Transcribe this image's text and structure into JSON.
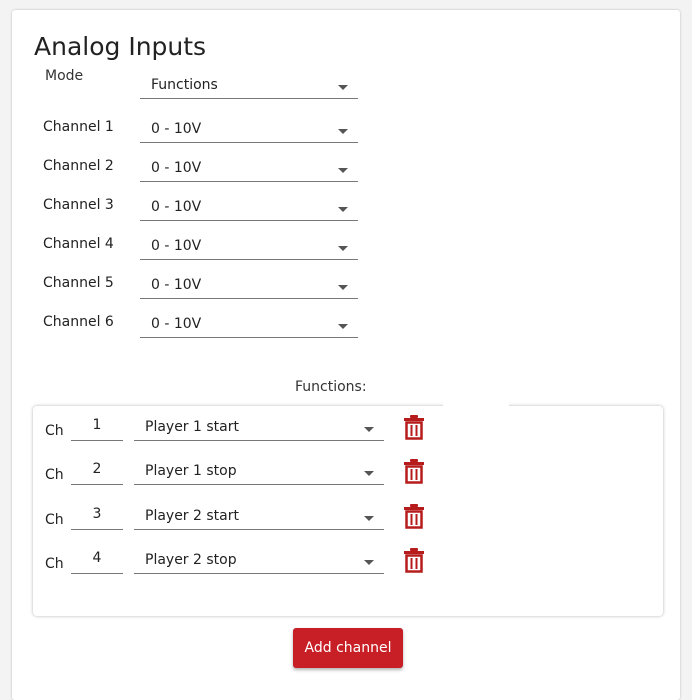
{
  "section": {
    "title": "Analog Inputs"
  },
  "mode": {
    "label": "Mode",
    "value": "Functions"
  },
  "channels": [
    {
      "label": "Channel 1",
      "value": "0 - 10V"
    },
    {
      "label": "Channel 2",
      "value": "0 - 10V"
    },
    {
      "label": "Channel 3",
      "value": "0 - 10V"
    },
    {
      "label": "Channel 4",
      "value": "0 - 10V"
    },
    {
      "label": "Channel 5",
      "value": "0 - 10V"
    },
    {
      "label": "Channel 6",
      "value": "0 - 10V"
    }
  ],
  "functions": {
    "heading": "Functions:",
    "rows": [
      {
        "ch_label": "Ch",
        "channel": "1",
        "function": "Player 1 start",
        "delete_icon": "trash-icon"
      },
      {
        "ch_label": "Ch",
        "channel": "2",
        "function": "Player 1 stop",
        "delete_icon": "trash-icon"
      },
      {
        "ch_label": "Ch",
        "channel": "3",
        "function": "Player 2 start",
        "delete_icon": "trash-icon"
      },
      {
        "ch_label": "Ch",
        "channel": "4",
        "function": "Player 2 stop",
        "delete_icon": "trash-icon"
      }
    ]
  },
  "actions": {
    "add_channel": "Add channel"
  },
  "colors": {
    "accent": "#c81e25",
    "trash": "#b71c1c"
  }
}
